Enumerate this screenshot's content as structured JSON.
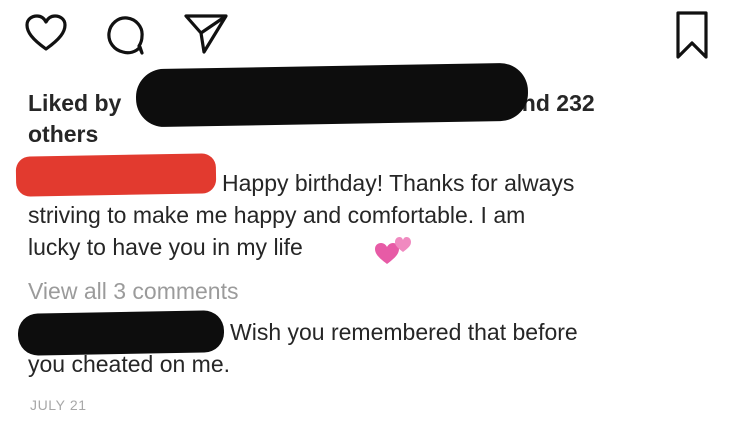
{
  "post": {
    "likes": {
      "prefix": "Liked by",
      "count_text": "and 232",
      "suffix": "others"
    },
    "caption": {
      "line1": "Happy birthday! Thanks for always",
      "line2": "striving to make me happy and comfortable. I am",
      "line3": "lucky to have you in my life"
    },
    "view_comments": "View all 3 comments",
    "comment": {
      "line1": "Wish you remembered that before",
      "line2": "you cheated on me."
    },
    "timestamp": "JULY 21"
  },
  "icons": {
    "like": "heart-outline-icon",
    "comment": "comment-bubble-icon",
    "share": "paper-plane-icon",
    "save": "bookmark-icon",
    "emoji": "two-hearts-emoji"
  },
  "colors": {
    "text": "#262626",
    "muted": "#9b9b9b",
    "redaction_black": "#0d0d0d",
    "redaction_red": "#e23a2f",
    "heart_pink": "#e75ba6"
  }
}
